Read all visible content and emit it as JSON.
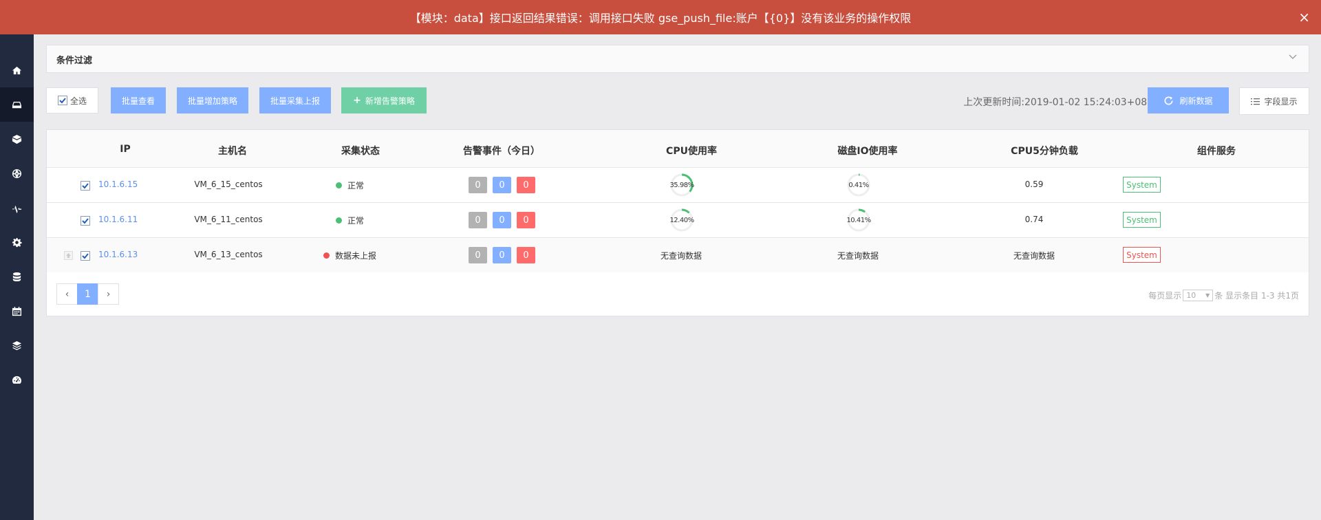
{
  "banner": {
    "message": "【模块：data】接口返回结果错误：调用接口失败 gse_push_file:账户【{0}】没有该业务的操作权限",
    "close": "×",
    "color": "#c84e3e"
  },
  "sidebar": {
    "items": [
      {
        "icon": "home-icon",
        "active": false
      },
      {
        "icon": "server-icon",
        "active": true
      },
      {
        "icon": "package-icon",
        "active": false
      },
      {
        "icon": "globe-icon",
        "active": false
      },
      {
        "icon": "pulse-icon",
        "active": false
      },
      {
        "icon": "gear-icon",
        "active": false
      },
      {
        "icon": "database-icon",
        "active": false
      },
      {
        "icon": "calendar-icon",
        "active": false
      },
      {
        "icon": "layers-icon",
        "active": false
      },
      {
        "icon": "dashboard-icon",
        "active": false
      }
    ]
  },
  "filter": {
    "title": "条件过滤"
  },
  "toolbar": {
    "select_all": "全选",
    "batch_view": "批量查看",
    "batch_add_policy": "批量增加策略",
    "batch_collect_report": "批量采集上报",
    "new_alert_policy": "新增告警策略",
    "last_updated": "上次更新时间:2019-01-02 15:24:03+0800",
    "refresh": "刷新数据",
    "field_display": "字段显示"
  },
  "table": {
    "headers": [
      "IP",
      "主机名",
      "采集状态",
      "告警事件（今日）",
      "CPU使用率",
      "磁盘IO使用率",
      "CPU5分钟负载",
      "组件服务"
    ],
    "rows": [
      {
        "ip": "10.1.6.15",
        "hostname": "VM_6_15_centos",
        "status": "正常",
        "status_color": "#4bbf73",
        "alerts": [
          "0",
          "0",
          "0"
        ],
        "cpu": "35.98%",
        "cpu_value": 35.98,
        "disk_io": "0.41%",
        "disk_io_value": 0.41,
        "load5": "0.59",
        "service": "System",
        "service_color": "#4bbf73",
        "upload_icon": false
      },
      {
        "ip": "10.1.6.11",
        "hostname": "VM_6_11_centos",
        "status": "正常",
        "status_color": "#4bbf73",
        "alerts": [
          "0",
          "0",
          "0"
        ],
        "cpu": "12.40%",
        "cpu_value": 12.4,
        "disk_io": "10.41%",
        "disk_io_value": 10.41,
        "load5": "0.74",
        "service": "System",
        "service_color": "#4bbf73",
        "upload_icon": false
      },
      {
        "ip": "10.1.6.13",
        "hostname": "VM_6_13_centos",
        "status": "数据未上报",
        "status_color": "#ef5350",
        "alerts": [
          "0",
          "0",
          "0"
        ],
        "cpu": "无查询数据",
        "disk_io": "无查询数据",
        "load5": "无查询数据",
        "service": "System",
        "service_color": "#ef5350",
        "upload_icon": true
      }
    ]
  },
  "pagination": {
    "prev": "‹",
    "current": "1",
    "next": "›",
    "per_page_label": "每页显示",
    "per_page": "10",
    "info": "条 显示条目 1-3 共1页"
  }
}
